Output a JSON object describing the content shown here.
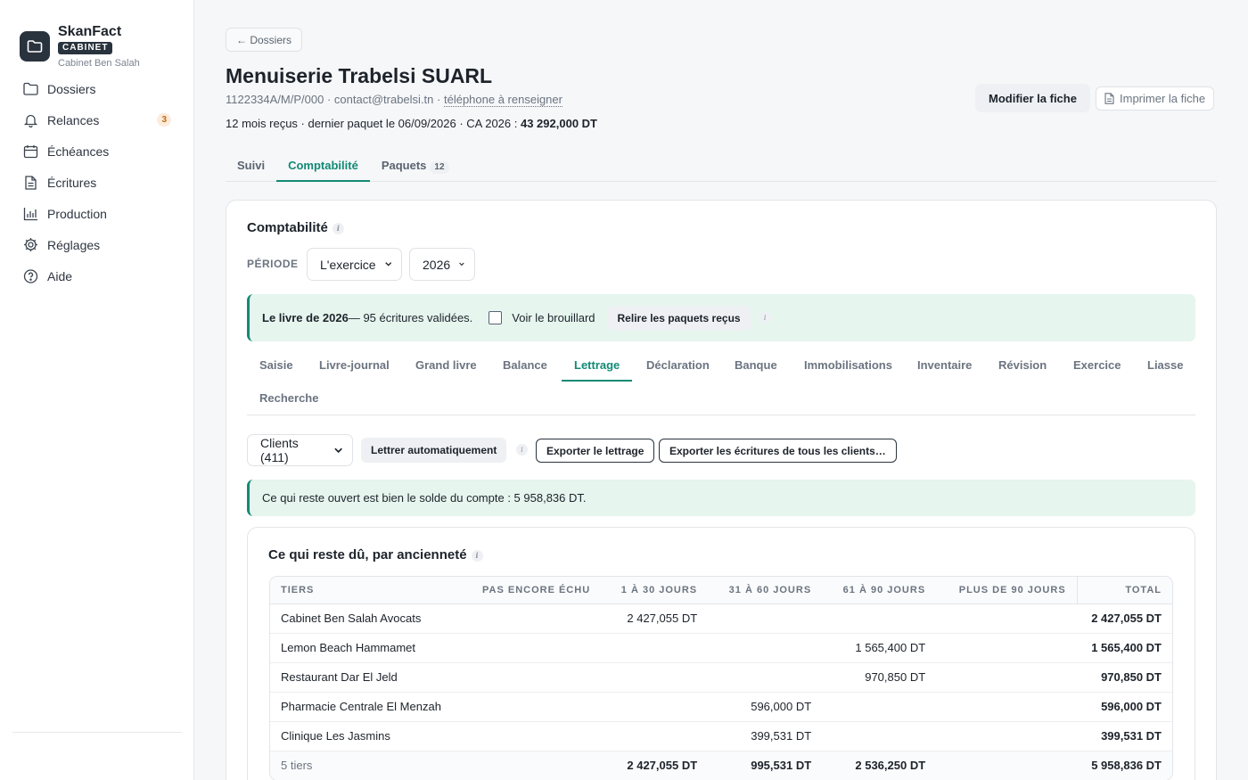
{
  "brand": {
    "name": "SkanFact",
    "badge": "CABINET",
    "subtitle": "Cabinet Ben Salah",
    "icon": "folder-icon"
  },
  "nav": [
    {
      "label": "Dossiers",
      "icon": "folder-icon"
    },
    {
      "label": "Relances",
      "icon": "bell-icon",
      "badge": "3"
    },
    {
      "label": "Échéances",
      "icon": "calendar-icon"
    },
    {
      "label": "Écritures",
      "icon": "document-icon"
    },
    {
      "label": "Production",
      "icon": "bar-chart-icon"
    },
    {
      "label": "Réglages",
      "icon": "gear-icon"
    },
    {
      "label": "Aide",
      "icon": "help-icon"
    }
  ],
  "header": {
    "back_label": "← Dossiers",
    "title": "Menuiserie Trabelsi SUARL",
    "meta_id": "1122334A/M/P/000",
    "meta_email": "contact@trabelsi.tn",
    "meta_phone": "téléphone à renseigner",
    "stats_prefix": "12 mois reçus · dernier paquet le 06/09/2026 · CA 2026 : ",
    "stats_ca": "43 292,000 DT",
    "edit_label": "Modifier la fiche",
    "print_label": "Imprimer la fiche"
  },
  "tabs": [
    {
      "label": "Suivi"
    },
    {
      "label": "Comptabilité",
      "active": true
    },
    {
      "label": "Paquets",
      "count": "12"
    }
  ],
  "compta": {
    "title": "Comptabilité",
    "periode_label": "PÉRIODE",
    "periode_value": "L'exercice",
    "year_value": "2026",
    "banner_bold": "Le livre de 2026",
    "banner_text": " — 95 écritures validées.",
    "brouillard_label": "Voir le brouillard",
    "relire_label": "Relire les paquets reçus"
  },
  "subtabs": [
    "Saisie",
    "Livre-journal",
    "Grand livre",
    "Balance",
    "Lettrage",
    "Déclaration",
    "Banque",
    "Immobilisations",
    "Inventaire",
    "Révision",
    "Exercice",
    "Liasse",
    "Recherche"
  ],
  "lettrage": {
    "account_select": "Clients (411)",
    "auto_label": "Lettrer automatiquement",
    "export_label": "Exporter le lettrage",
    "export_all_label": "Exporter les écritures de tous les clients…",
    "solde_text": "Ce qui reste ouvert est bien le solde du compte : 5 958,836 DT."
  },
  "aging": {
    "title": "Ce qui reste dû, par ancienneté",
    "columns": [
      "TIERS",
      "PAS ENCORE ÉCHU",
      "1 À 30 JOURS",
      "31 À 60 JOURS",
      "61 À 90 JOURS",
      "PLUS DE 90 JOURS",
      "TOTAL"
    ],
    "rows": [
      [
        "Cabinet Ben Salah Avocats",
        "",
        "2 427,055 DT",
        "",
        "",
        "",
        "2 427,055 DT"
      ],
      [
        "Lemon Beach Hammamet",
        "",
        "",
        "",
        "1 565,400 DT",
        "",
        "1 565,400 DT"
      ],
      [
        "Restaurant Dar El Jeld",
        "",
        "",
        "",
        "970,850 DT",
        "",
        "970,850 DT"
      ],
      [
        "Pharmacie Centrale El Menzah",
        "",
        "",
        "596,000 DT",
        "",
        "",
        "596,000 DT"
      ],
      [
        "Clinique Les Jasmins",
        "",
        "",
        "399,531 DT",
        "",
        "",
        "399,531 DT"
      ]
    ],
    "footer": [
      "5 tiers",
      "",
      "2 427,055 DT",
      "995,531 DT",
      "2 536,250 DT",
      "",
      "5 958,836 DT"
    ]
  }
}
